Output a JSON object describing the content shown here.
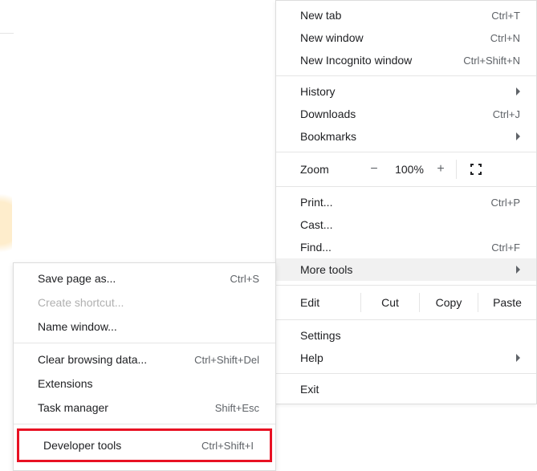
{
  "main_menu": {
    "new_tab": {
      "label": "New tab",
      "shortcut": "Ctrl+T"
    },
    "new_window": {
      "label": "New window",
      "shortcut": "Ctrl+N"
    },
    "new_incognito": {
      "label": "New Incognito window",
      "shortcut": "Ctrl+Shift+N"
    },
    "history": {
      "label": "History"
    },
    "downloads": {
      "label": "Downloads",
      "shortcut": "Ctrl+J"
    },
    "bookmarks": {
      "label": "Bookmarks"
    },
    "zoom": {
      "label": "Zoom",
      "minus": "−",
      "value": "100%",
      "plus": "+"
    },
    "print": {
      "label": "Print...",
      "shortcut": "Ctrl+P"
    },
    "cast": {
      "label": "Cast..."
    },
    "find": {
      "label": "Find...",
      "shortcut": "Ctrl+F"
    },
    "more_tools": {
      "label": "More tools"
    },
    "edit": {
      "label": "Edit",
      "cut": "Cut",
      "copy": "Copy",
      "paste": "Paste"
    },
    "settings": {
      "label": "Settings"
    },
    "help": {
      "label": "Help"
    },
    "exit": {
      "label": "Exit"
    }
  },
  "sub_menu": {
    "save_page": {
      "label": "Save page as...",
      "shortcut": "Ctrl+S"
    },
    "create_shortcut": {
      "label": "Create shortcut..."
    },
    "name_window": {
      "label": "Name window..."
    },
    "clear_data": {
      "label": "Clear browsing data...",
      "shortcut": "Ctrl+Shift+Del"
    },
    "extensions": {
      "label": "Extensions"
    },
    "task_manager": {
      "label": "Task manager",
      "shortcut": "Shift+Esc"
    },
    "dev_tools": {
      "label": "Developer tools",
      "shortcut": "Ctrl+Shift+I"
    }
  }
}
